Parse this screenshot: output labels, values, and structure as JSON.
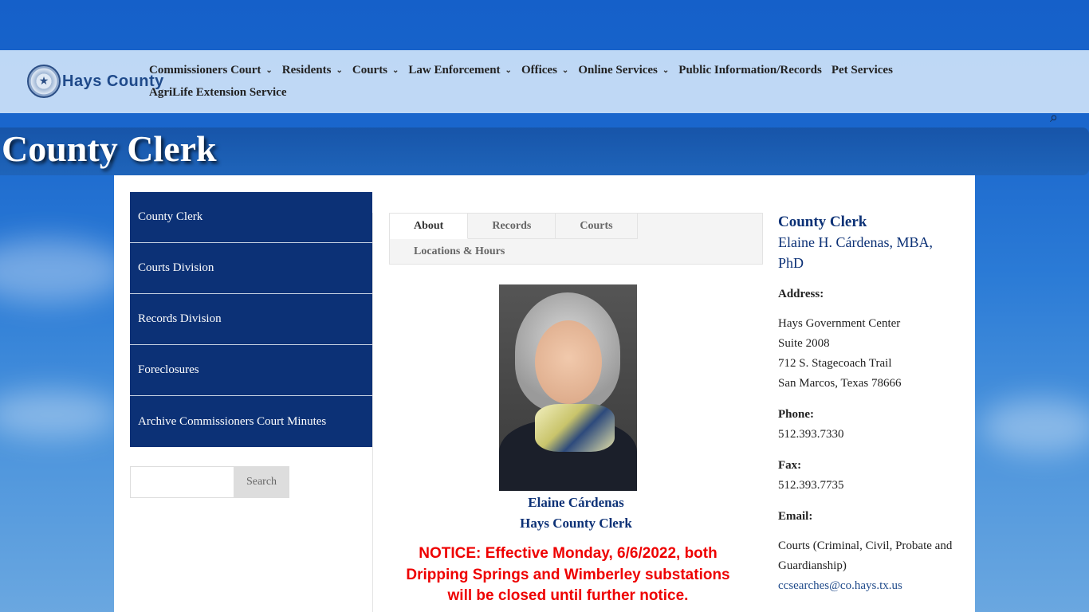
{
  "header": {
    "logo_text": "Hays County",
    "nav_row1": [
      {
        "label": "Commissioners Court",
        "dropdown": true
      },
      {
        "label": "Residents",
        "dropdown": true
      },
      {
        "label": "Courts",
        "dropdown": true
      },
      {
        "label": "Law Enforcement",
        "dropdown": true
      },
      {
        "label": "Offices",
        "dropdown": true
      },
      {
        "label": "Online Services",
        "dropdown": true
      },
      {
        "label": "Public Information/Records",
        "dropdown": false
      },
      {
        "label": "Pet Services",
        "dropdown": false
      }
    ],
    "nav_row2": [
      {
        "label": "AgriLife Extension Service",
        "dropdown": false
      }
    ]
  },
  "page_title": "County Clerk",
  "sidebar": {
    "items": [
      {
        "label": "County Clerk"
      },
      {
        "label": "Courts Division"
      },
      {
        "label": "Records Division"
      },
      {
        "label": "Foreclosures"
      },
      {
        "label": "Archive Commissioners Court Minutes"
      }
    ],
    "search_placeholder": "",
    "search_button": "Search"
  },
  "tabs": {
    "row1": [
      {
        "label": "About",
        "active": true
      },
      {
        "label": "Records",
        "active": false
      },
      {
        "label": "Courts",
        "active": false
      }
    ],
    "row2": [
      {
        "label": "Locations & Hours",
        "active": false
      }
    ]
  },
  "caption": {
    "name": "Elaine Cárdenas",
    "role": "Hays County Clerk"
  },
  "notice": "NOTICE: Effective Monday, 6/6/2022, both Dripping Springs and Wimberley substations will be closed until further notice.",
  "info": {
    "title": "County Clerk",
    "name": "Elaine H. Cárdenas, MBA, PhD",
    "address_label": "Address:",
    "address_lines": [
      "Hays Government Center",
      "Suite 2008",
      "712 S. Stagecoach Trail",
      "San Marcos, Texas 78666"
    ],
    "phone_label": "Phone:",
    "phone": "512.393.7330",
    "fax_label": "Fax:",
    "fax": "512.393.7735",
    "email_label": "Email:",
    "email_desc": "Courts (Criminal, Civil, Probate and Guardianship)",
    "email": "ccsearches@co.hays.tx.us"
  },
  "colors": {
    "brand_navy": "#0c3176",
    "notice_red": "#ee0000"
  }
}
